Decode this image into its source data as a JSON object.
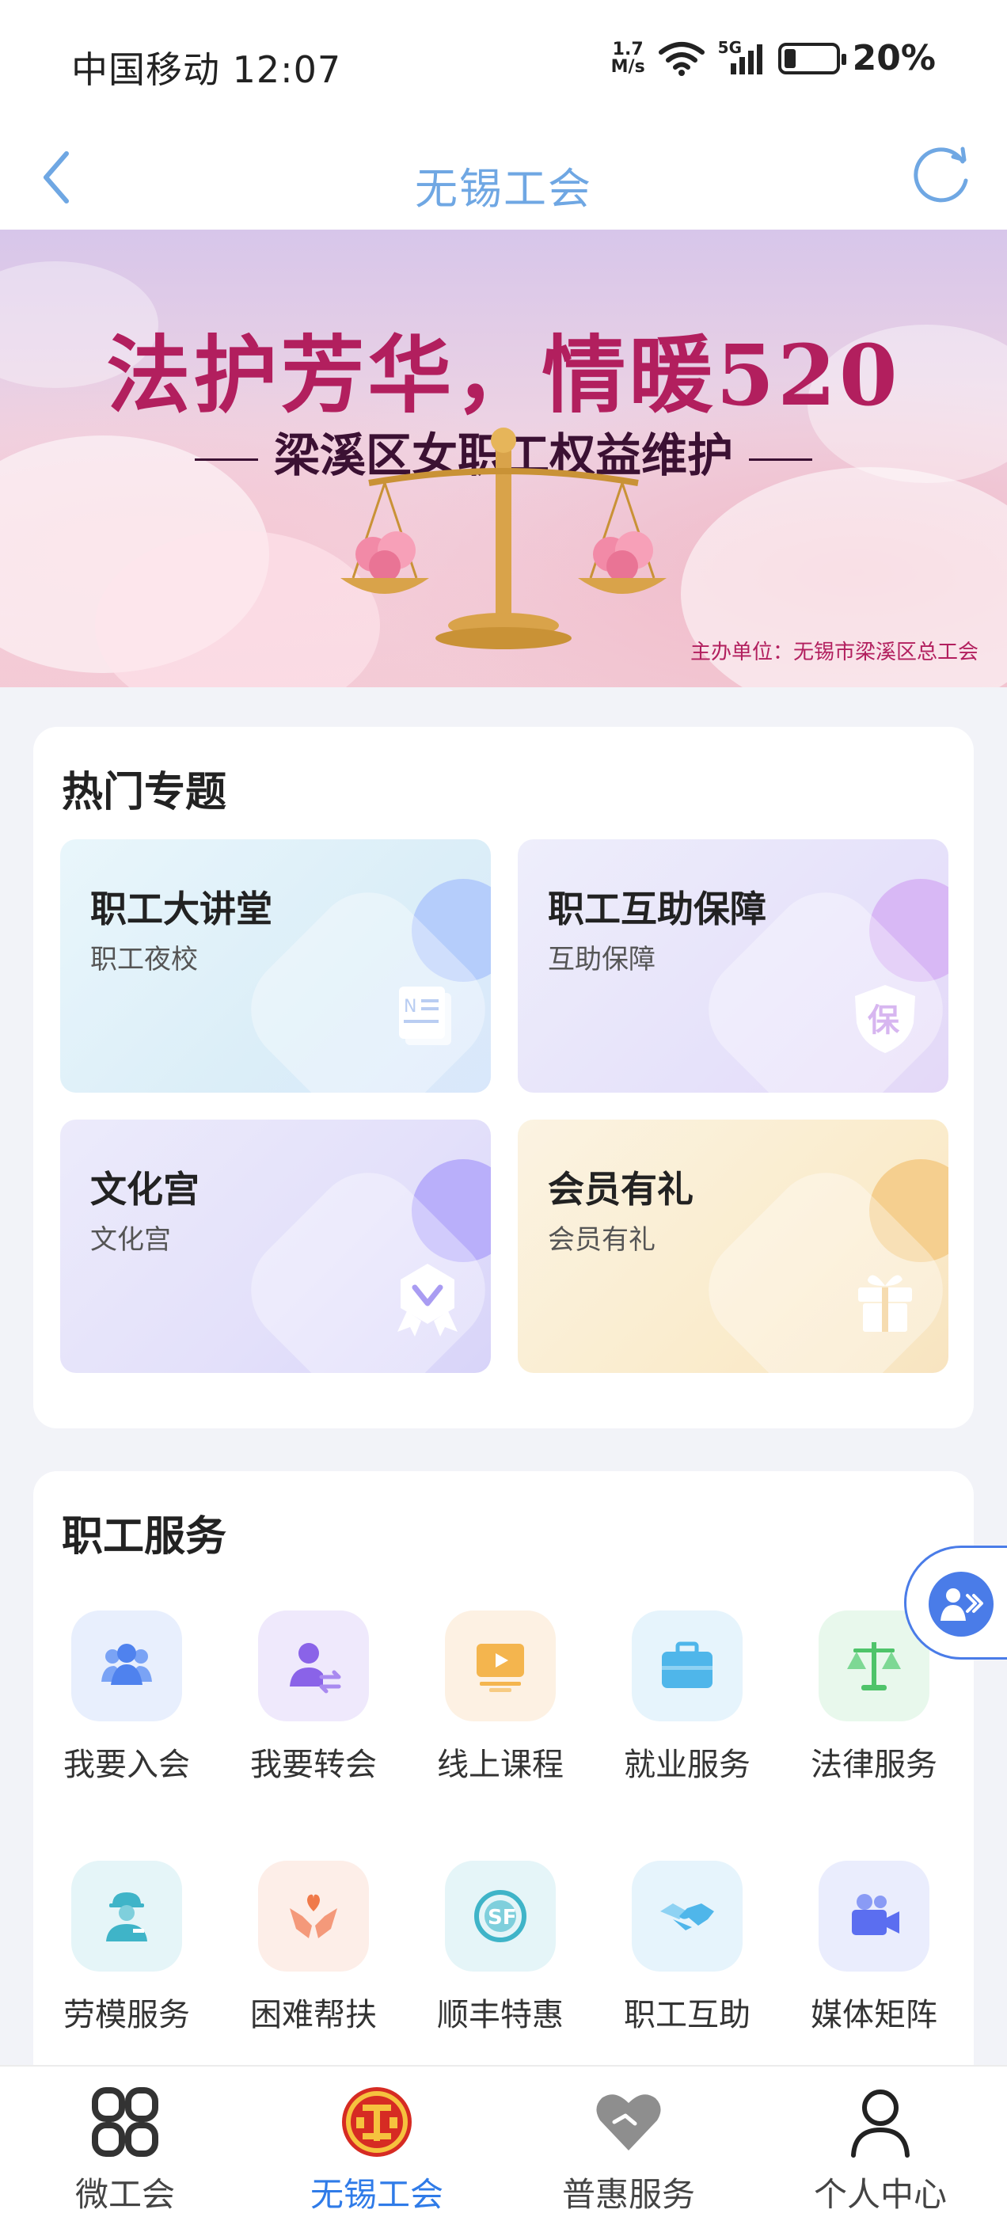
{
  "status": {
    "carrier": "中国移动",
    "time": "12:07",
    "net_speed_value": "1.7",
    "net_speed_unit": "M/s",
    "network": "5G",
    "battery": "20%"
  },
  "nav": {
    "title": "无锡工会"
  },
  "banner": {
    "title": "法护芳华，情暖520",
    "subtitle": "梁溪区女职工权益维护",
    "organizer": "主办单位：无锡市梁溪区总工会"
  },
  "hot_topics": {
    "title": "热门专题",
    "tiles": [
      {
        "title": "职工大讲堂",
        "subtitle": "职工夜校",
        "icon": "notebook-icon"
      },
      {
        "title": "职工互助保障",
        "subtitle": "互助保障",
        "icon": "shield-icon"
      },
      {
        "title": "文化宫",
        "subtitle": "文化宫",
        "icon": "badge-icon"
      },
      {
        "title": "会员有礼",
        "subtitle": "会员有礼",
        "icon": "gift-icon"
      }
    ]
  },
  "services": {
    "title": "职工服务",
    "items": [
      {
        "label": "我要入会",
        "icon": "group-icon",
        "color": "#5b8ef0"
      },
      {
        "label": "我要转会",
        "icon": "user-transfer-icon",
        "color": "#8a63e8"
      },
      {
        "label": "线上课程",
        "icon": "video-course-icon",
        "color": "#f0a53a"
      },
      {
        "label": "就业服务",
        "icon": "briefcase-icon",
        "color": "#4fb6ea"
      },
      {
        "label": "法律服务",
        "icon": "scale-icon",
        "color": "#4fc46a"
      },
      {
        "label": "劳模服务",
        "icon": "worker-icon",
        "color": "#3fb4c8"
      },
      {
        "label": "困难帮扶",
        "icon": "helping-hands-icon",
        "color": "#f07a4a"
      },
      {
        "label": "顺丰特惠",
        "icon": "sf-icon",
        "color": "#3fb4c8"
      },
      {
        "label": "职工互助",
        "icon": "handshake-icon",
        "color": "#4fb6ea"
      },
      {
        "label": "媒体矩阵",
        "icon": "camera-icon",
        "color": "#5b6ef0"
      }
    ]
  },
  "tabbar": {
    "tabs": [
      {
        "label": "微工会",
        "icon": "grid-icon"
      },
      {
        "label": "无锡工会",
        "icon": "union-emblem-icon",
        "active": true
      },
      {
        "label": "普惠服务",
        "icon": "heart-icon"
      },
      {
        "label": "个人中心",
        "icon": "person-icon"
      }
    ]
  }
}
